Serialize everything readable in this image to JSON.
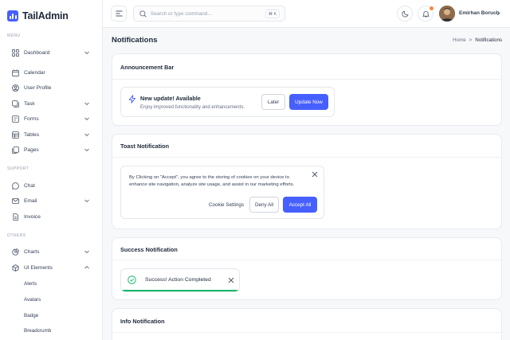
{
  "app": {
    "name": "TailAdmin"
  },
  "sidebar": {
    "sections": {
      "menu": "MENU",
      "support": "SUPPORT",
      "others": "OTHERS"
    },
    "menu": [
      {
        "label": "Dashboard",
        "icon": "grid-icon",
        "has_chevron": true
      },
      {
        "label": "Calendar",
        "icon": "calendar-icon",
        "has_chevron": false
      },
      {
        "label": "User Profile",
        "icon": "user-icon",
        "has_chevron": false
      },
      {
        "label": "Task",
        "icon": "task-icon",
        "has_chevron": true
      },
      {
        "label": "Forms",
        "icon": "forms-icon",
        "has_chevron": true
      },
      {
        "label": "Tables",
        "icon": "table-icon",
        "has_chevron": true
      },
      {
        "label": "Pages",
        "icon": "pages-icon",
        "has_chevron": true
      }
    ],
    "support": [
      {
        "label": "Chat",
        "icon": "chat-icon",
        "has_chevron": false
      },
      {
        "label": "Email",
        "icon": "mail-icon",
        "has_chevron": true
      },
      {
        "label": "Invoice",
        "icon": "invoice-icon",
        "has_chevron": false
      }
    ],
    "others": [
      {
        "label": "Charts",
        "icon": "pie-chart-icon",
        "has_chevron": true
      },
      {
        "label": "UI Elements",
        "icon": "box-icon",
        "has_chevron": true,
        "expanded": true
      }
    ],
    "ui_elements_sub": [
      "Alerts",
      "Avatars",
      "Badge",
      "Breadcrumb"
    ]
  },
  "header": {
    "search_placeholder": "Search or type command...",
    "search_shortcut": "⌘ K",
    "user_name": "Emirhan Boruch"
  },
  "page": {
    "title": "Notifications",
    "breadcrumb": {
      "home": "Home",
      "separator": ">",
      "current": "Notifications"
    }
  },
  "announcement": {
    "card_title": "Announcement Bar",
    "heading": "New update! Available",
    "body": "Enjoy improved functionality and enhancements.",
    "later_label": "Later",
    "update_label": "Update Now"
  },
  "toast": {
    "card_title": "Toast Notification",
    "line1": "By Clicking on \"Accept\", you agree to the storing of cookies on your device to",
    "line2": "enhance site navigation, analyze site usage, and assist in our marketing efforts.",
    "settings_label": "Cookie Settings",
    "deny_label": "Deny All",
    "accept_label": "Accept All"
  },
  "success": {
    "card_title": "Success Notification",
    "message": "Success! Action Completed"
  },
  "info": {
    "card_title": "Info Notification"
  },
  "colors": {
    "primary": "#465fff",
    "success": "#12b76a",
    "notification_dot": "#fd853a"
  }
}
